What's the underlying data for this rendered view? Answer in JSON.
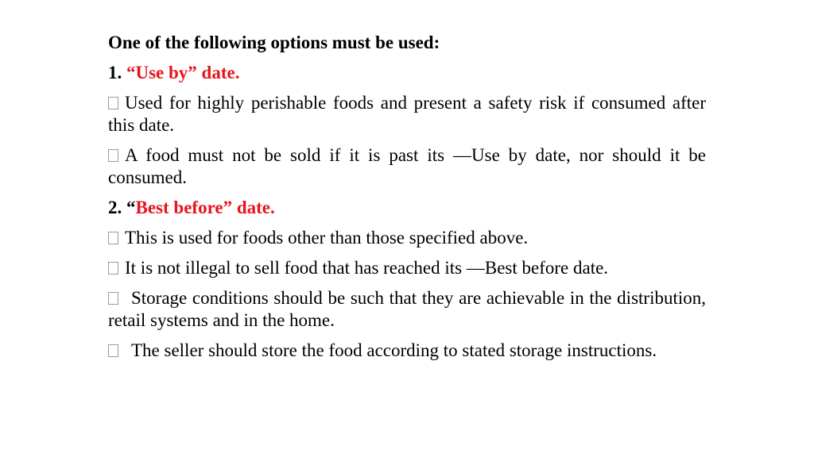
{
  "slide": {
    "title": "One of the following options must be used:",
    "sections": [
      {
        "number": "1.",
        "prefix_black": "",
        "label_red": "“Use by” date.",
        "suffix_black": "",
        "bullets": [
          {
            "icon": "missing-glyph-box-icon",
            "text": "Used for highly perishable foods and present a safety risk if consumed after this date."
          },
          {
            "icon": "missing-glyph-box-icon",
            "text": "A food must not be sold if it is past its —Use by date, nor should it be consumed."
          }
        ]
      },
      {
        "number": "2.",
        "prefix_black": "“",
        "label_red": "Best before” date.",
        "suffix_black": "",
        "bullets": [
          {
            "icon": "missing-glyph-box-icon",
            "text": "This is used for foods other than those specified above."
          },
          {
            "icon": "missing-glyph-box-icon",
            "text": "It is not illegal to sell food that has reached its —Best before date."
          },
          {
            "icon": "missing-glyph-box-icon",
            "text": "Storage conditions should be such that they are achievable in the distribution, retail systems and in the home."
          },
          {
            "icon": "missing-glyph-box-icon",
            "text": "The seller should store the food according to stated storage instructions."
          }
        ]
      }
    ],
    "colors": {
      "accent_red": "#e8141b",
      "text": "#000000",
      "bullet_box": "#9a9a9a"
    }
  }
}
